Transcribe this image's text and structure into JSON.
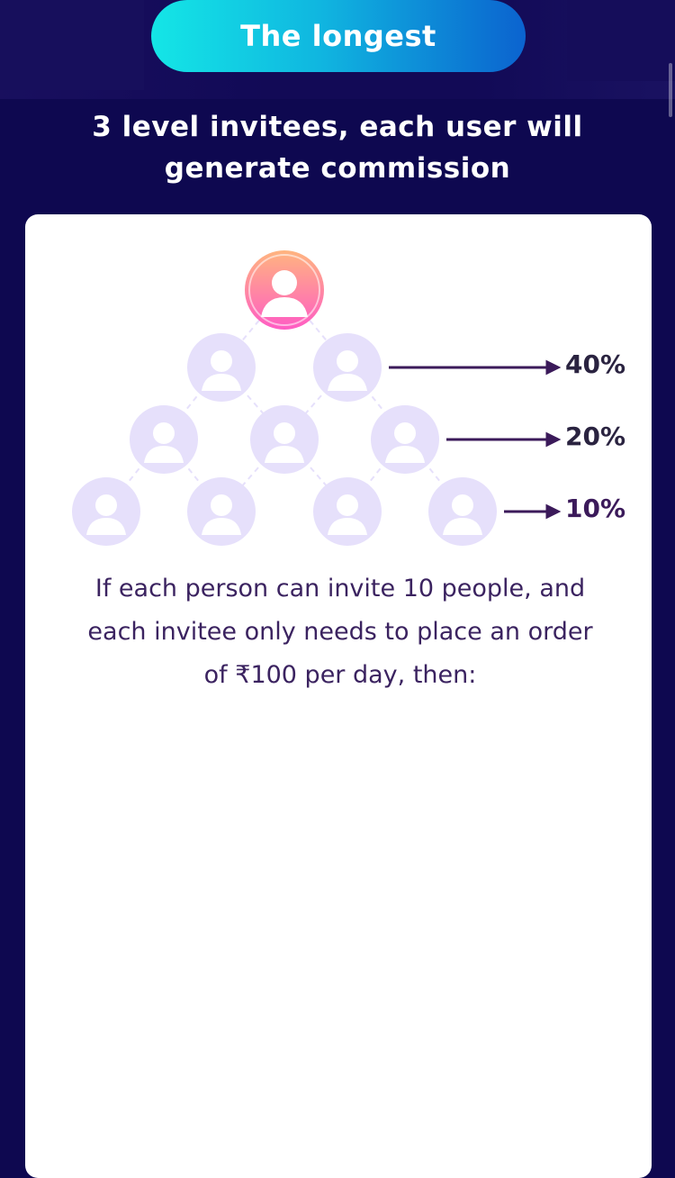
{
  "header": {
    "pill_label": "The longest",
    "subtitle": "3 level invitees, each user will generate commission"
  },
  "diagram": {
    "levels": [
      {
        "level": 1,
        "percent": "40%"
      },
      {
        "level": 2,
        "percent": "20%"
      },
      {
        "level": 3,
        "percent": "10%"
      }
    ],
    "icon": "person-avatar-icon"
  },
  "description": "If each person can invite 10 people, and each invitee only needs to place an order of ₹100 per day, then:",
  "colors": {
    "background": "#0e0850",
    "pill_gradient_start": "#14e6e6",
    "pill_gradient_end": "#0b63cf",
    "root_avatar_start": "#ffb57f",
    "root_avatar_end": "#ff5cc4",
    "node_avatar": "#e6e0fb",
    "arrow": "#3b1a5a",
    "text_dark": "#3b2360"
  }
}
